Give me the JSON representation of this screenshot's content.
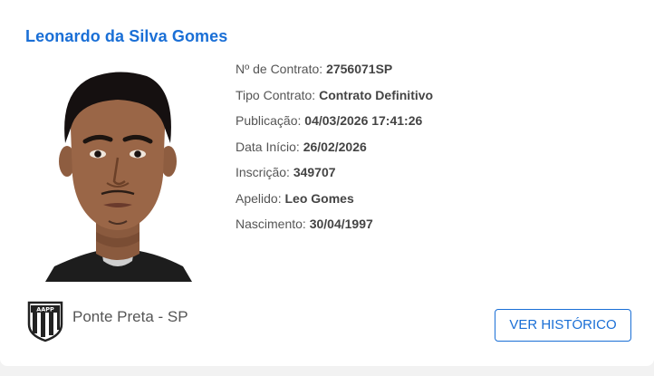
{
  "player": {
    "name": "Leonardo da Silva Gomes"
  },
  "details": [
    {
      "label": "Nº de Contrato: ",
      "value": "2756071SP"
    },
    {
      "label": "Tipo Contrato: ",
      "value": "Contrato Definitivo"
    },
    {
      "label": "Publicação: ",
      "value": "04/03/2026 17:41:26"
    },
    {
      "label": "Data Início: ",
      "value": "26/02/2026"
    },
    {
      "label": "Inscrição: ",
      "value": "349707"
    },
    {
      "label": "Apelido: ",
      "value": "Leo Gomes"
    },
    {
      "label": "Nascimento: ",
      "value": "30/04/1997"
    }
  ],
  "club": {
    "name": "Ponte Preta - SP",
    "logo_icon": "aapp-crest-icon",
    "logo_text": "AAPP"
  },
  "actions": {
    "history_label": "VER HISTÓRICO"
  },
  "colors": {
    "accent": "#1a6fd6",
    "text": "#555555",
    "background": "#f2f2f2"
  }
}
